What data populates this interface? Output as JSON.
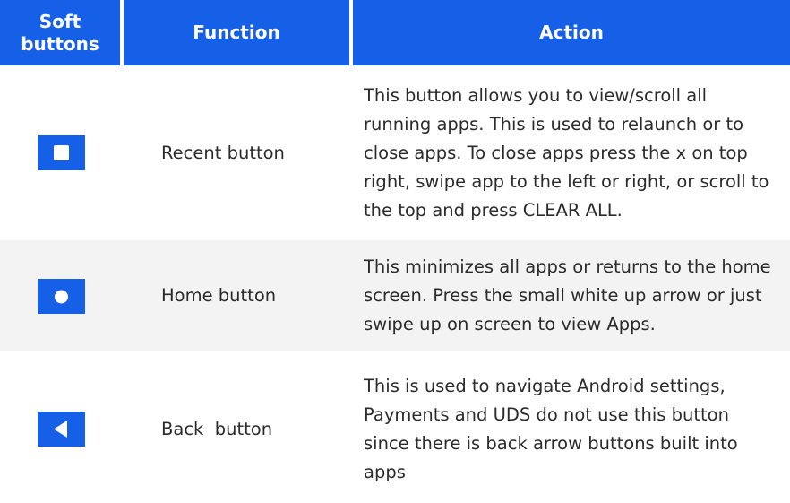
{
  "headers": {
    "soft_buttons": "Soft buttons",
    "function": "Function",
    "action": "Action"
  },
  "rows": [
    {
      "icon": "recent-square-icon",
      "function": "Recent button",
      "action": "This button allows you to view/scroll all running apps. This is used to relaunch or to close apps. To close apps press the x on top right, swipe app to the left or right, or scroll to the top and press CLEAR ALL."
    },
    {
      "icon": "home-circle-icon",
      "function": "Home button",
      "action": "This minimizes all apps or returns to the home screen. Press the small white up arrow or just swipe up on screen to view Apps."
    },
    {
      "icon": "back-triangle-icon",
      "function": "Back  button",
      "action": "This is used to navigate Android settings, Payments and UDS do not use this button since there is back arrow buttons built into apps"
    }
  ],
  "colors": {
    "header_background": "#1660e8",
    "header_text": "#ffffff",
    "icon_background": "#1660e8",
    "alt_row_background": "#f3f3f3"
  }
}
